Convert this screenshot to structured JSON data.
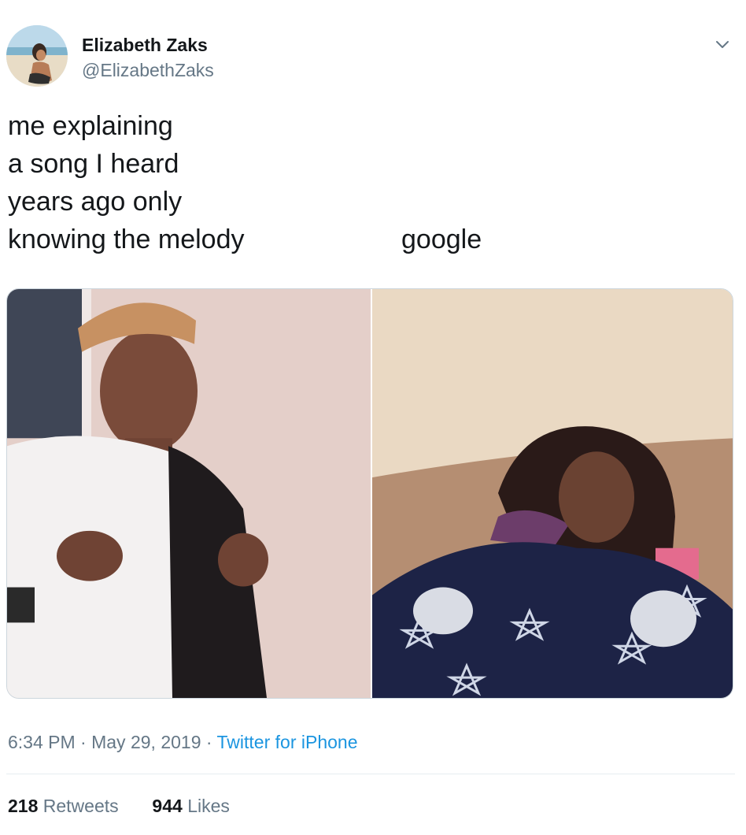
{
  "author": {
    "name": "Elizabeth Zaks",
    "handle": "@ElizabethZaks"
  },
  "tweet": {
    "text_lines": [
      "me explaining",
      "a song I heard",
      "years ago only",
      "knowing the melody"
    ],
    "caption_right": "google"
  },
  "meta": {
    "time": "6:34 PM",
    "date": "May 29, 2019",
    "source": "Twitter for iPhone",
    "separator": "·"
  },
  "stats": {
    "retweets_count": "218",
    "retweets_label": "Retweets",
    "likes_count": "944",
    "likes_label": "Likes"
  },
  "icons": {
    "menu": "chevron-down-icon"
  },
  "colors": {
    "secondary_text": "#657786",
    "link": "#1b95e0",
    "border": "#ccd6dd"
  }
}
